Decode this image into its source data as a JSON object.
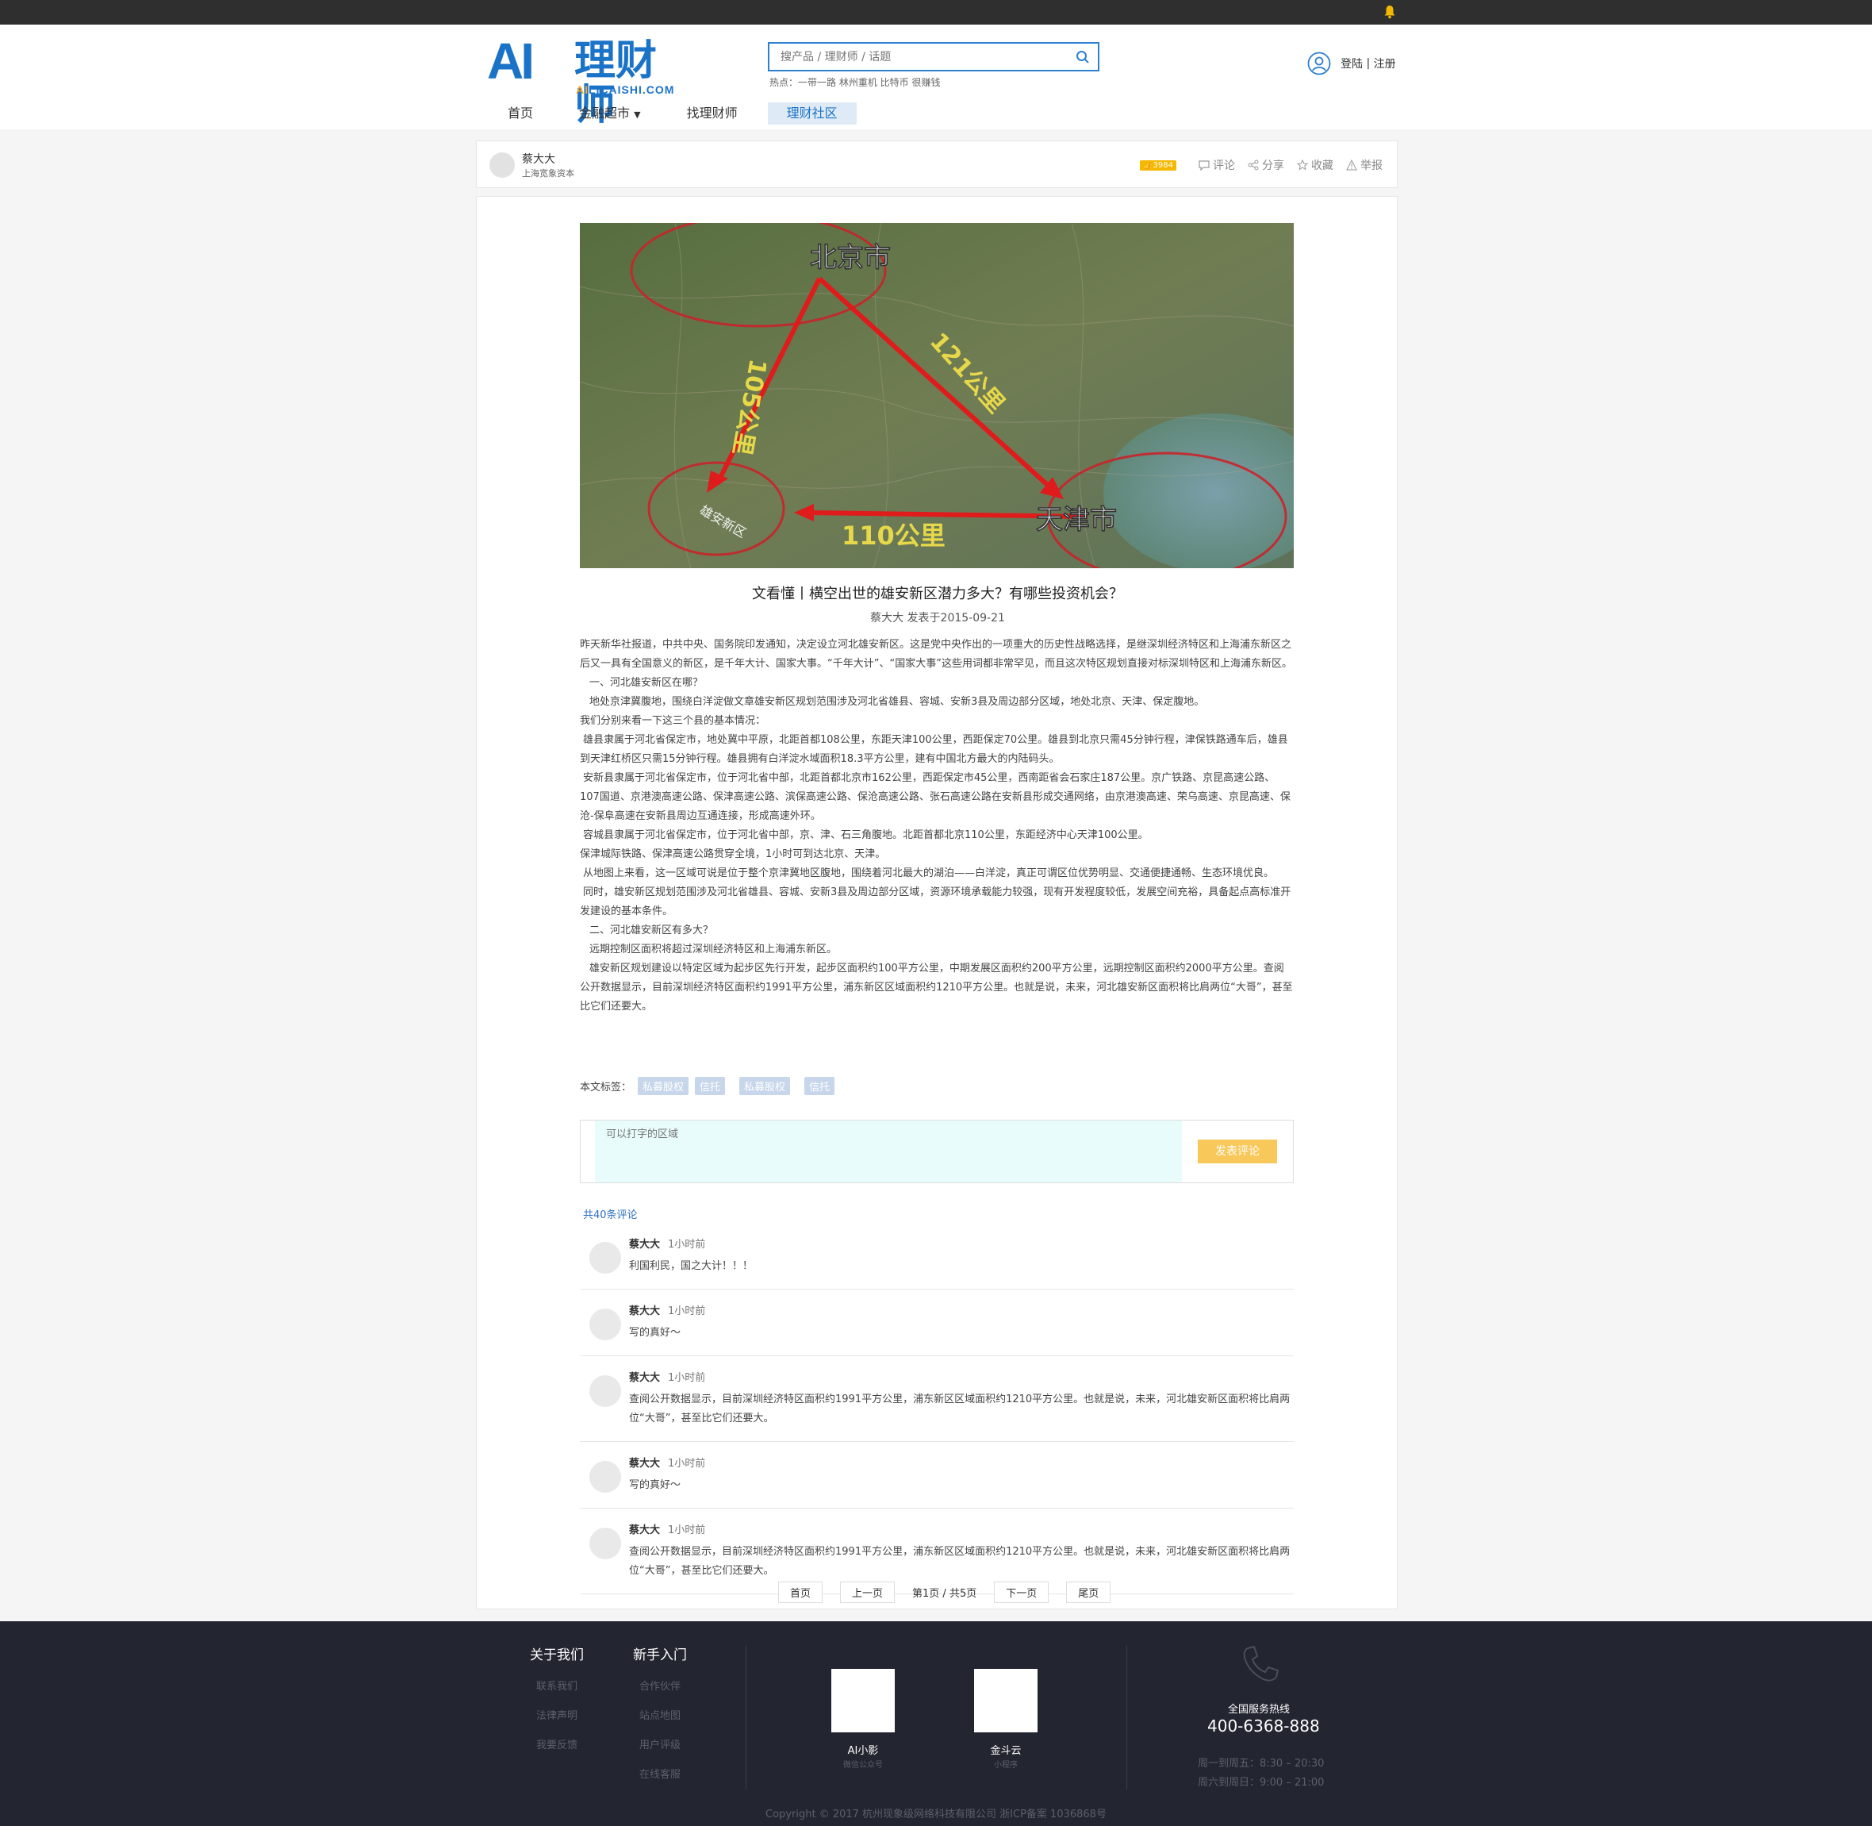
{
  "header": {
    "logo_main": "AI",
    "logo_cn": "理财师",
    "logo_sub_a": "AI",
    "logo_sub_b": "LICAISHI.COM",
    "search_placeholder": "搜产品 / 理财师 / 话题",
    "hot_searches": "热点：一带一路 林州重机 比特币 很赚钱",
    "login": "登陆",
    "separator": " | ",
    "register": "注册"
  },
  "nav": [
    {
      "label": "首页"
    },
    {
      "label": "金融超市"
    },
    {
      "label": "找理财师"
    },
    {
      "label": "理财社区"
    }
  ],
  "author_bar": {
    "name": "蔡大大",
    "org": "上海宽象资本",
    "likes": "3984",
    "actions": [
      "评论",
      "分享",
      "收藏",
      "举报"
    ]
  },
  "article": {
    "title": "文看懂丨横空出世的雄安新区潜力多大？有哪些投资机会？",
    "meta": "蔡大大 发表于2015-09-21",
    "hero_labels": {
      "beijing": "北京市",
      "tianjin": "天津市",
      "xiongan": "雄安新区",
      "d1": "105公里",
      "d2": "121公里",
      "d3": "110公里"
    },
    "paragraphs": [
      "昨天新华社报道，中共中央、国务院印发通知，决定设立河北雄安新区。这是党中央作出的一项重大的历史性战略选择，是继深圳经济特区和上海浦东新区之后又一具有全国意义的新区，是千年大计、国家大事。“千年大计”、“国家大事”这些用词都非常罕见，而且这次特区规划直接对标深圳特区和上海浦东新区。",
      "一、河北雄安新区在哪？",
      "地处京津冀腹地，围绕白洋淀做文章雄安新区规划范围涉及河北省雄县、容城、安新3县及周边部分区域，地处北京、天津、保定腹地。",
      "我们分别来看一下这三个县的基本情况：",
      "雄县隶属于河北省保定市，地处冀中平原，北距首都108公里，东距天津100公里，西距保定70公里。雄县到北京只需45分钟行程，津保铁路通车后，雄县到天津红桥区只需15分钟行程。雄县拥有白洋淀水域面积18.3平方公里，建有中国北方最大的内陆码头。",
      "安新县隶属于河北省保定市，位于河北省中部，北距首都北京市162公里，西距保定市45公里，西南距省会石家庄187公里。京广铁路、京昆高速公路、107国道、京港澳高速公路、保津高速公路、滨保高速公路、保沧高速公路、张石高速公路在安新县形成交通网络，由京港澳高速、荣乌高速、京昆高速、保沧-保阜高速在安新县周边互通连接，形成高速外环。",
      "容城县隶属于河北省保定市，位于河北省中部，京、津、石三角腹地。北距首都北京110公里，东距经济中心天津100公里。",
      "保津城际铁路、保津高速公路贯穿全境，1小时可到达北京、天津。",
      "从地图上来看，这一区域可说是位于整个京津冀地区腹地，围绕着河北最大的湖泊——白洋淀，真正可谓区位优势明显、交通便捷通畅、生态环境优良。",
      "同时，雄安新区规划范围涉及河北省雄县、容城、安新3县及周边部分区域，资源环境承载能力较强，现有开发程度较低，发展空间充裕，具备起点高标准开发建设的基本条件。",
      "二、河北雄安新区有多大？",
      "远期控制区面积将超过深圳经济特区和上海浦东新区。",
      "雄安新区规划建设以特定区域为起步区先行开发，起步区面积约100平方公里，中期发展区面积约200平方公里，远期控制区面积约2000平方公里。查阅公开数据显示，目前深圳经济特区面积约1991平方公里，浦东新区区域面积约1210平方公里。也就是说，未来，河北雄安新区面积将比肩两位“大哥”，甚至比它们还要大。"
    ],
    "tags_label": "本文标签：",
    "tags": [
      "私募股权",
      "信托",
      "私募股权",
      "信托"
    ]
  },
  "comment_form": {
    "placeholder": "可以打字的区域",
    "submit": "发表评论"
  },
  "comments": {
    "count_label": "共40条评论",
    "items": [
      {
        "name": "蔡大大",
        "time": "1小时前",
        "text": "利国利民，国之大计！！！"
      },
      {
        "name": "蔡大大",
        "time": "1小时前",
        "text": "写的真好～"
      },
      {
        "name": "蔡大大",
        "time": "1小时前",
        "text": "查阅公开数据显示，目前深圳经济特区面积约1991平方公里，浦东新区区域面积约1210平方公里。也就是说，未来，河北雄安新区面积将比肩两位“大哥”，甚至比它们还要大。"
      },
      {
        "name": "蔡大大",
        "time": "1小时前",
        "text": "写的真好～"
      },
      {
        "name": "蔡大大",
        "time": "1小时前",
        "text": "查阅公开数据显示，目前深圳经济特区面积约1991平方公里，浦东新区区域面积约1210平方公里。也就是说，未来，河北雄安新区面积将比肩两位“大哥”，甚至比它们还要大。"
      }
    ]
  },
  "pager": {
    "first": "首页",
    "prev": "上一页",
    "info": "第1页 / 共5页",
    "next": "下一页",
    "last": "尾页"
  },
  "footer": {
    "col1_title": "关于我们",
    "col1_links": [
      "联系我们",
      "法律声明",
      "我要反馈"
    ],
    "col2_title": "新手入门",
    "col2_links": [
      "合作伙伴",
      "站点地图",
      "用户评级",
      "在线客服"
    ],
    "qr1_label": "AI小影",
    "qr1_sub": "微信公众号",
    "qr2_label": "金斗云",
    "qr2_sub": "小程序",
    "hotline_label": "全国服务热线",
    "hotline": "400-6368-888",
    "hours1": "周一到周五：8:30 – 20:30",
    "hours2": "周六到周日：9:00 – 21:00",
    "copyright": "Copyright © 2017 杭州现象级网络科技有限公司 浙ICP备案 1036868号"
  },
  "colors": {
    "brand_blue": "#1a73c7",
    "accent_yellow": "#f5b800",
    "footer_bg": "#232631",
    "topbar_bg": "#2f2f2f"
  }
}
